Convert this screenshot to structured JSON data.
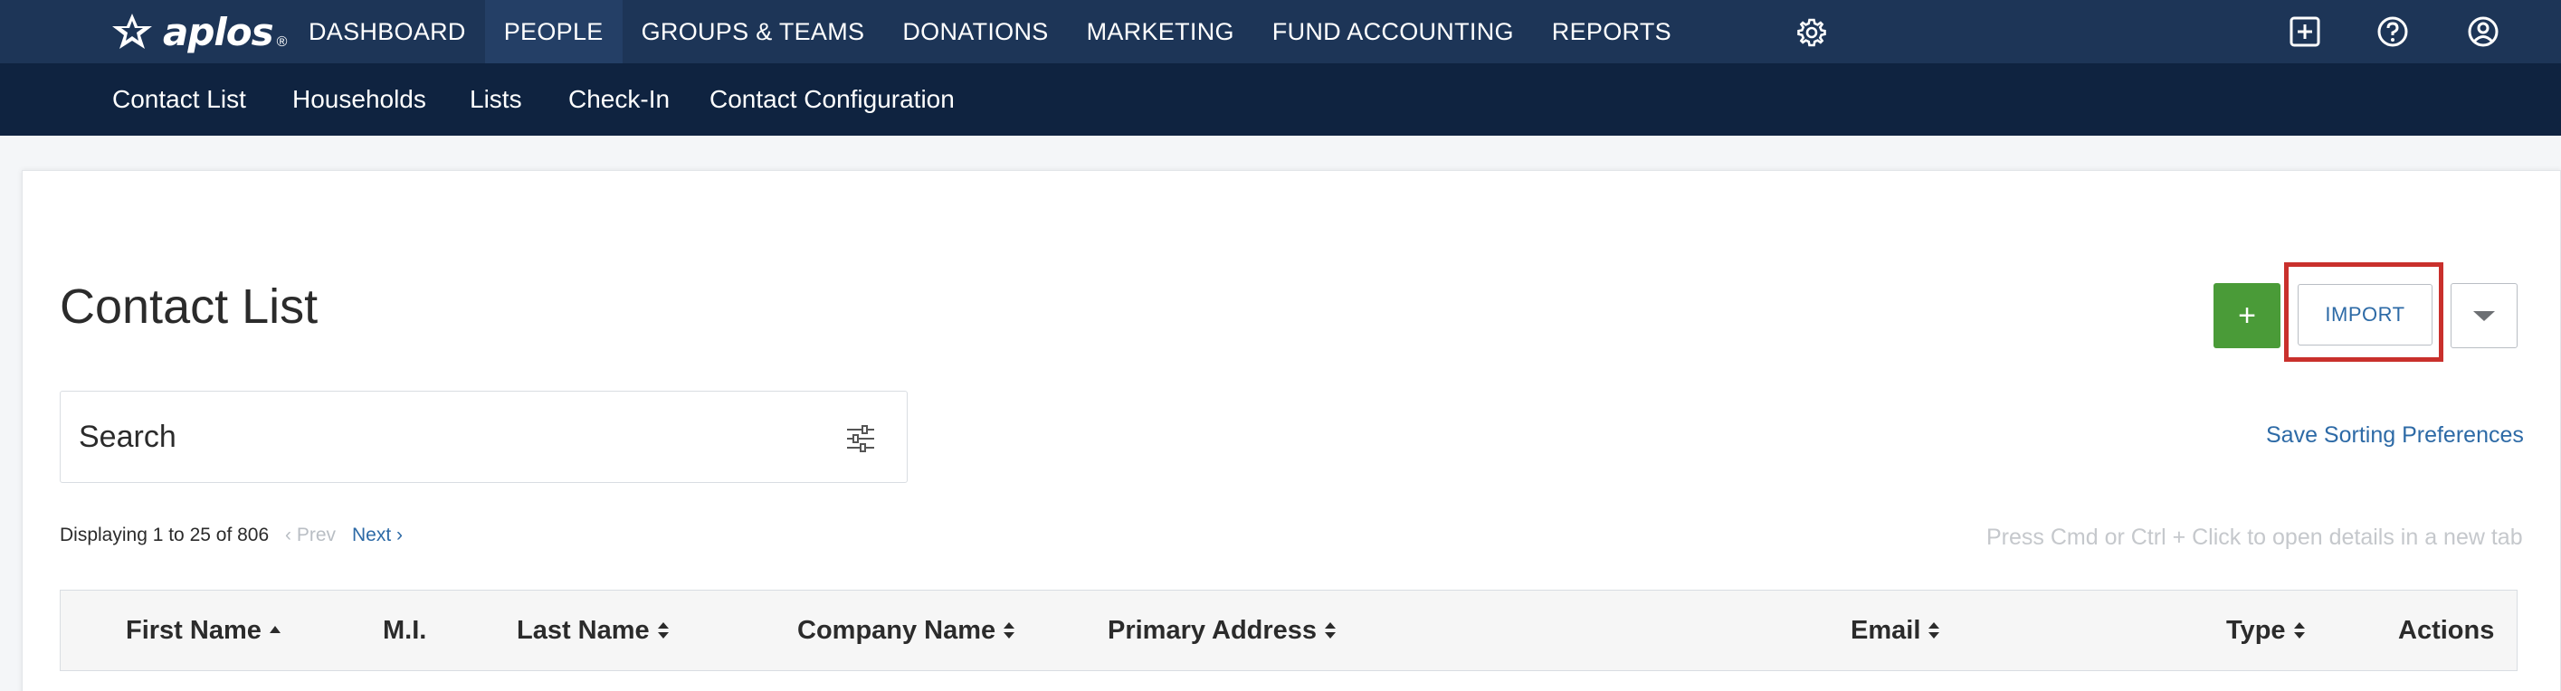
{
  "brand": {
    "logo_text": "aplos",
    "registered": "®"
  },
  "topnav": {
    "items": [
      {
        "label": "DASHBOARD"
      },
      {
        "label": "PEOPLE"
      },
      {
        "label": "GROUPS & TEAMS"
      },
      {
        "label": "DONATIONS"
      },
      {
        "label": "MARKETING"
      },
      {
        "label": "FUND ACCOUNTING"
      },
      {
        "label": "REPORTS"
      }
    ],
    "active_item": "PEOPLE",
    "icons": [
      "gear-icon",
      "add-square-icon",
      "help-circle-icon",
      "user-circle-icon"
    ]
  },
  "subnav": {
    "items": [
      {
        "label": "Contact List"
      },
      {
        "label": "Households"
      },
      {
        "label": "Lists"
      },
      {
        "label": "Check-In"
      },
      {
        "label": "Contact Configuration"
      }
    ]
  },
  "page": {
    "title": "Contact List",
    "add_button_label": "+",
    "import_button_label": "IMPORT",
    "save_sorting_label": "Save Sorting Preferences"
  },
  "search": {
    "placeholder": "Search",
    "value": ""
  },
  "pagination": {
    "displaying": "Displaying 1 to 25 of 806",
    "prev_label": "‹ Prev",
    "next_label": "Next ›"
  },
  "hint": "Press Cmd or Ctrl + Click to open details in a new tab",
  "table": {
    "columns": [
      {
        "label": "First Name",
        "sort": "asc"
      },
      {
        "label": "M.I.",
        "sort": "none"
      },
      {
        "label": "Last Name",
        "sort": "both"
      },
      {
        "label": "Company Name",
        "sort": "both"
      },
      {
        "label": "Primary Address",
        "sort": "both"
      },
      {
        "label": "Email",
        "sort": "both"
      },
      {
        "label": "Type",
        "sort": "both"
      },
      {
        "label": "Actions",
        "sort": "none"
      }
    ]
  },
  "colors": {
    "nav_bg": "#1d3557",
    "subnav_bg": "#0f2340",
    "accent_green": "#4a9b38",
    "link_blue": "#2d6aa6",
    "highlight_red": "#c9302c"
  }
}
